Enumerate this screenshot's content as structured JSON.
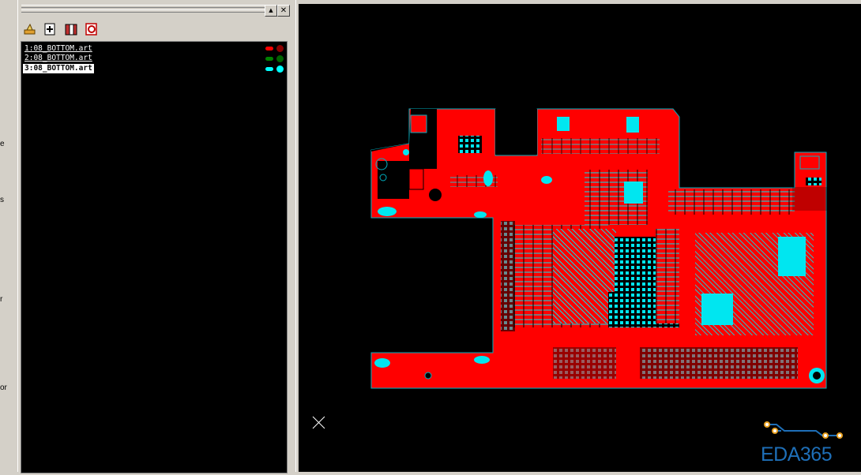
{
  "window": {
    "minimize_glyph": "▲",
    "close_glyph": "✕"
  },
  "left_edge_letters": [
    "e",
    "s",
    "r",
    "or"
  ],
  "toolbar": {
    "icons": [
      "open-file-icon",
      "add-layer-icon",
      "layer-stack-icon",
      "delete-layer-icon"
    ]
  },
  "layers": [
    {
      "label": "1:08_BOTTOM.art",
      "color": "#ff0000",
      "dot": "#8b0000",
      "selected": false
    },
    {
      "label": "2:08_BOTTOM.art",
      "color": "#008000",
      "dot": "#006400",
      "selected": false
    },
    {
      "label": "3:08_BOTTOM.art",
      "color": "#00ffff",
      "dot": "#00ffff",
      "selected": true
    }
  ],
  "colors": {
    "copper": "#ff0000",
    "pads": "#00e6f0",
    "board_outline": "#00b0c0",
    "background": "#000000"
  },
  "logo": {
    "text": "EDA365"
  }
}
